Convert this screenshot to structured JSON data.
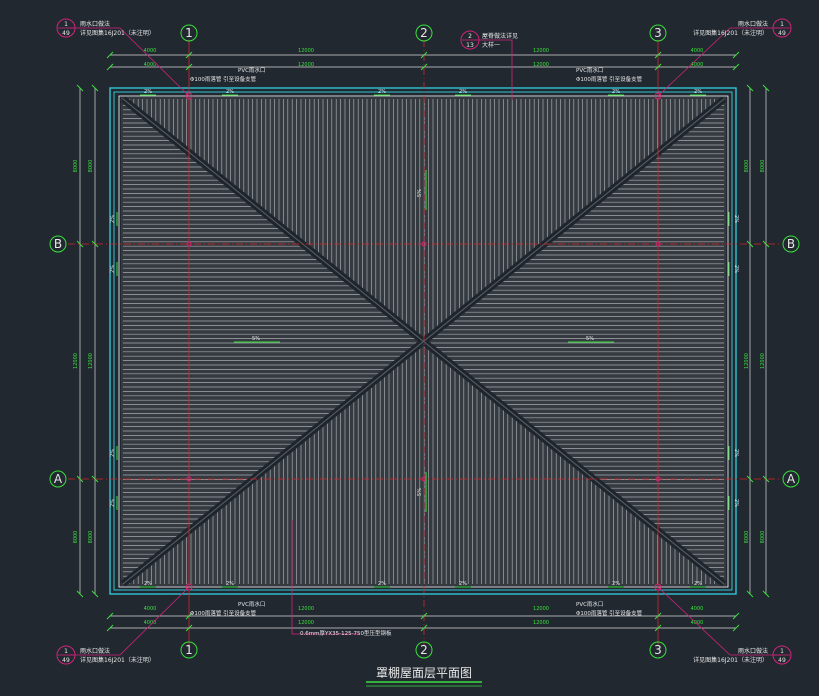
{
  "drawing_title": "罩棚屋面层平面图",
  "axes": {
    "columns": [
      "1",
      "2",
      "3"
    ],
    "rows": [
      "B",
      "A"
    ]
  },
  "dims": {
    "top_outer": [
      "4000",
      "12000",
      "12000",
      "4000"
    ],
    "top_inner": [
      "4000",
      "12000",
      "12000",
      "4000"
    ],
    "bottom_outer": [
      "4000",
      "12000",
      "12000",
      "4000"
    ],
    "bottom_inner": [
      "4000",
      "12000",
      "12000",
      "4000"
    ],
    "left_outer": [
      "8000",
      "12000",
      "8000"
    ],
    "left_inner": [
      "8000",
      "12000",
      "8000"
    ],
    "right_outer": [
      "8000",
      "12000",
      "8000"
    ],
    "right_inner": [
      "8000",
      "12000",
      "8000"
    ]
  },
  "callouts": {
    "top_left": {
      "num": "1",
      "sheet": "49",
      "line1": "雨水口做法",
      "line2": "详见图集16J201（未注明）"
    },
    "top_right": {
      "num": "1",
      "sheet": "49",
      "line1": "雨水口做法",
      "line2": "详见图集16J201（未注明）"
    },
    "bottom_left": {
      "num": "1",
      "sheet": "49",
      "line1": "雨水口做法",
      "line2": "详见图集16J201（未注明）"
    },
    "bottom_right": {
      "num": "1",
      "sheet": "49",
      "line1": "雨水口做法",
      "line2": "详见图集16J201（未注明）"
    },
    "top_center": {
      "num": "2",
      "sheet": "13",
      "line1": "屋脊做法详见",
      "line2": "大样一"
    }
  },
  "notes": {
    "pvc_outlet": "PVC雨水口",
    "pipe": "Φ100雨落管 引至设备支管",
    "panel": "0.6mm厚YX35-125-750型压型钢板",
    "slope_big": "5%",
    "slope_small": "2%"
  },
  "colors": {
    "background": "#212830",
    "roof_panel": "#353a40",
    "ribs": "#a6aaaf",
    "ridge": "#1f252c",
    "cyan": "#2fc6d6",
    "green": "#39e03c",
    "red_axis": "#d0282c",
    "magenta": "#d2237a",
    "white": "#e8e8e8"
  }
}
